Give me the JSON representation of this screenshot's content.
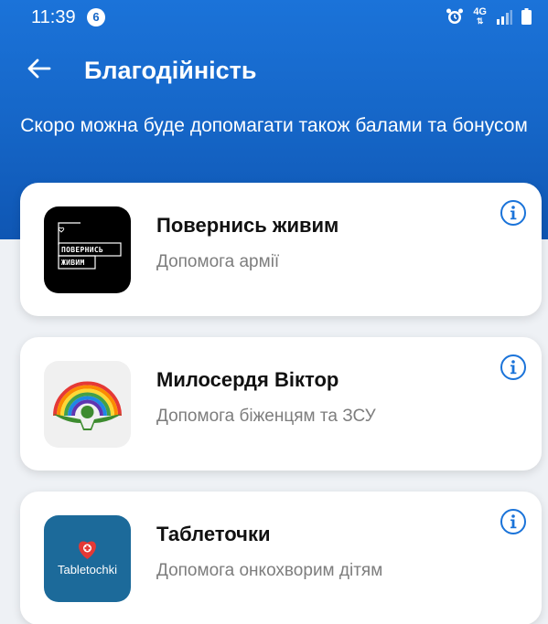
{
  "status_bar": {
    "time": "11:39",
    "notification_count": "6",
    "network": "4G"
  },
  "header": {
    "title": "Благодійність",
    "subtitle": "Скоро можна буде допомагати також балами та бонусом"
  },
  "charities": [
    {
      "title": "Повернись живим",
      "subtitle": "Допомога армії",
      "logo_text_1": "ПОВЕРНИСЬ",
      "logo_text_2": "ЖИВИМ",
      "logo_bg": "#000000"
    },
    {
      "title": "Милосердя Віктор",
      "subtitle": "Допомога біженцям та ЗСУ",
      "logo_bg": "#f0f0f0"
    },
    {
      "title": "Таблеточки",
      "subtitle": "Допомога онкохворим дітям",
      "logo_text": "Tabletochki",
      "logo_bg": "#1c6a9a"
    }
  ],
  "colors": {
    "header_blue": "#1565c6",
    "info_icon": "#1a73d9"
  }
}
